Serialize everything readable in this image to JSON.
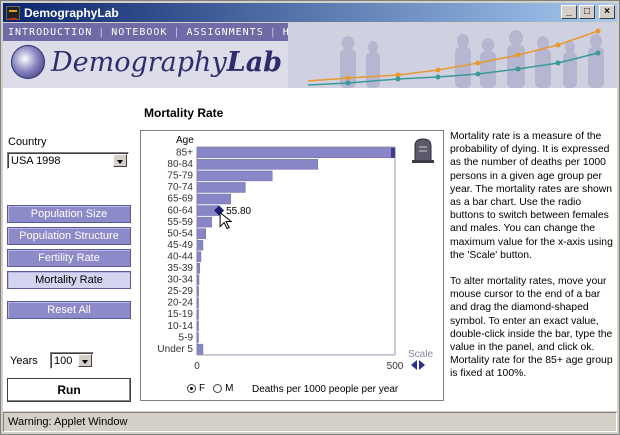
{
  "window": {
    "title": "DemographyLab"
  },
  "topnav": [
    "INTRODUCTION",
    "NOTEBOOK",
    "ASSIGNMENTS",
    "HELP"
  ],
  "logo": {
    "part1": "Demography",
    "part2": "Lab"
  },
  "sidebar": {
    "country_label": "Country",
    "country_value": "USA 1998",
    "buttons": [
      "Population Size",
      "Population Structure",
      "Fertility Rate",
      "Mortality Rate"
    ],
    "active_button": "Mortality Rate",
    "reset_label": "Reset All",
    "years_label": "Years",
    "years_value": "100",
    "run_label": "Run"
  },
  "section_title": "Mortality Rate",
  "radio": {
    "female_label": "F",
    "male_label": "M",
    "selected": "F"
  },
  "scale_label": "Scale",
  "chart_data": {
    "type": "bar",
    "orientation": "horizontal",
    "ylabel": "Age",
    "xlabel": "Deaths per 1000 people per year",
    "xlim": [
      0,
      500
    ],
    "xticks": [
      "0",
      "500"
    ],
    "categories": [
      "85+",
      "80-84",
      "75-79",
      "70-74",
      "65-69",
      "60-64",
      "55-59",
      "50-54",
      "45-49",
      "40-44",
      "35-39",
      "30-34",
      "25-29",
      "20-24",
      "15-19",
      "10-14",
      "5-9",
      "Under 5"
    ],
    "values": [
      1000,
      305,
      190,
      122,
      85,
      55.8,
      37,
      22,
      15,
      10,
      7,
      5,
      4,
      3.5,
      3,
      2,
      1.5,
      15
    ],
    "hover": {
      "category": "60-64",
      "label": "55.80"
    },
    "bar_color": "#8886c6"
  },
  "description": [
    "Mortality rate is a measure of the probability of dying. It is expressed as the number of deaths per 1000 persons in a given age group per year. The mortality rates are shown as a bar chart. Use the radio buttons to switch between females and males. You can change the maximum value for the x-axis using the 'Scale' button.",
    "To alter mortality rates, move your mouse cursor to the end of a bar and drag the diamond-shaped symbol. To enter an exact value, double-click inside the bar, type the value in the panel, and click ok. Mortality rate for the 85+ age group is fixed at 100%."
  ],
  "status": "Warning: Applet Window"
}
